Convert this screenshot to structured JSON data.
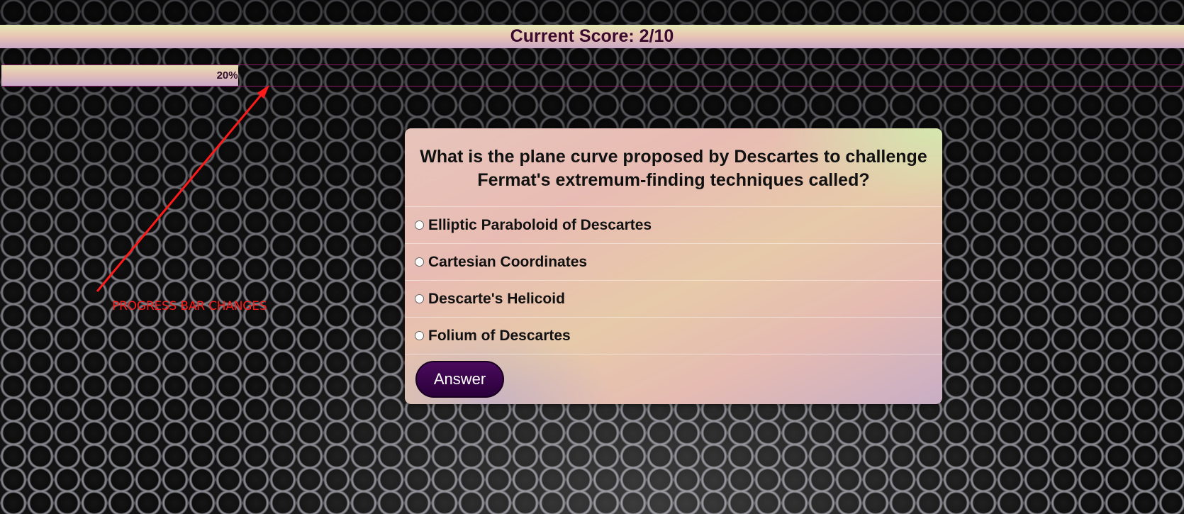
{
  "score": {
    "text": "Current Score: 2/10"
  },
  "progress": {
    "percent": 20,
    "label": "20%",
    "fill_color": "#e3c0b6",
    "border_color": "#8d1a6a"
  },
  "annotation": {
    "text": "PROGRESS BAR CHANGES",
    "color": "#ff1a1a"
  },
  "quiz": {
    "question": "What is the plane curve proposed by Descartes to challenge Fermat's extremum-finding techniques called?",
    "options": [
      {
        "label": "Elliptic Paraboloid of Descartes"
      },
      {
        "label": "Cartesian Coordinates"
      },
      {
        "label": "Descarte's Helicoid"
      },
      {
        "label": "Folium of Descartes"
      }
    ],
    "answer_button_label": "Answer",
    "button_color": "#3a0650"
  }
}
